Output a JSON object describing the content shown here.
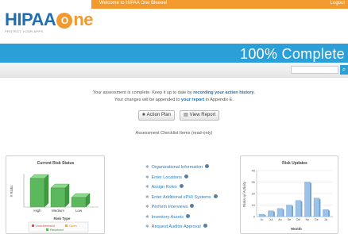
{
  "header": {
    "logo_main": "HIPAA",
    "logo_o": "O",
    "logo_ne": "ne",
    "logo_tagline": "PROTECT YOUR APPS",
    "welcome": "Welcome to HIPAA One Bleeeel",
    "logout": "Logout"
  },
  "progress": {
    "label": "100% Complete",
    "percent": 100
  },
  "message": {
    "line1_pre": "Your assessment is complete. Keep it up to date by ",
    "line1_link": "recording your action history",
    "line1_post": ".",
    "line2_pre": "Your changes will be appended to ",
    "line2_link": "your report",
    "line2_post": " in Appendix E."
  },
  "buttons": {
    "action_plan": "Action Plan",
    "view_report": "View Report"
  },
  "checklist": {
    "title": "Assessment Checklist Items (read-only)",
    "items": [
      "Organizational Information",
      "Enter Locations",
      "Assign Roles",
      "Enter Additional ePHI Systems",
      "Perform Interviews",
      "Inventory Assets",
      "Request Auditor Approval"
    ]
  },
  "risk_status_chart": {
    "chart_data": {
      "type": "bar",
      "title": "Current Risk Status",
      "xlabel": "Risk Type",
      "ylabel": "# Risks",
      "categories": [
        "High",
        "Medium",
        "Low"
      ],
      "values": [
        9,
        6,
        3
      ],
      "legend": [
        "Unaddressed",
        "Open",
        "Resolved"
      ],
      "legend_placement": "bottom",
      "colors": {
        "bar": "#5cb85c",
        "unaddressed": "#d9534f",
        "open": "#f0ad4e",
        "resolved": "#5cb85c"
      }
    }
  },
  "risk_updates_chart": {
    "chart_data": {
      "type": "bar",
      "title": "Risk Updates",
      "xlabel": "Month",
      "ylabel": "Risks w/ Activity",
      "categories": [
        "Ju",
        "Jul",
        "Au",
        "Se",
        "Oct",
        "No",
        "De",
        "Ja"
      ],
      "values": [
        2,
        5,
        7,
        10,
        14,
        30,
        16,
        6
      ],
      "yticks": [
        0,
        10,
        20,
        30,
        40
      ],
      "ylim": [
        0,
        40
      ],
      "colors": {
        "bar": "#9cc3e6",
        "bar_dark": "#6aa0d2"
      }
    }
  }
}
